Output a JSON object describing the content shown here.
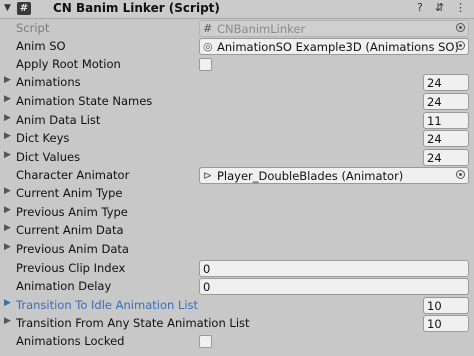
{
  "header": {
    "title": "CN Banim Linker (Script)",
    "component_icon": "#",
    "icons": [
      "help-icon",
      "presets-icon",
      "more-icon"
    ]
  },
  "rows": {
    "script": {
      "label": "Script",
      "value": "CNBanimLinker"
    },
    "anim_so": {
      "label": "Anim SO",
      "value": "AnimationSO Example3D (Animations SO)"
    },
    "apply_root_motion": {
      "label": "Apply Root Motion",
      "checked": false
    },
    "animations": {
      "label": "Animations",
      "value": "24"
    },
    "animation_state_names": {
      "label": "Animation State Names",
      "value": "24"
    },
    "anim_data_list": {
      "label": "Anim Data List",
      "value": "11"
    },
    "dict_keys": {
      "label": "Dict Keys",
      "value": "24"
    },
    "dict_values": {
      "label": "Dict Values",
      "value": "24"
    },
    "character_animator": {
      "label": "Character Animator",
      "value": "Player_DoubleBlades (Animator)"
    },
    "current_anim_type": {
      "label": "Current Anim Type"
    },
    "previous_anim_type": {
      "label": "Previous Anim Type"
    },
    "current_anim_data": {
      "label": "Current Anim Data"
    },
    "previous_anim_data": {
      "label": "Previous Anim Data"
    },
    "previous_clip_index": {
      "label": "Previous Clip Index",
      "value": "0"
    },
    "animation_delay": {
      "label": "Animation Delay",
      "value": "0"
    },
    "transition_to_idle": {
      "label": "Transition To Idle Animation List",
      "value": "10"
    },
    "transition_from_any": {
      "label": "Transition From Any State Animation List",
      "value": "10"
    },
    "animations_locked": {
      "label": "Animations Locked",
      "checked": false
    }
  },
  "colors": {
    "highlight_label": "#3a6fb8",
    "panel_bg": "#c8c8c8"
  }
}
